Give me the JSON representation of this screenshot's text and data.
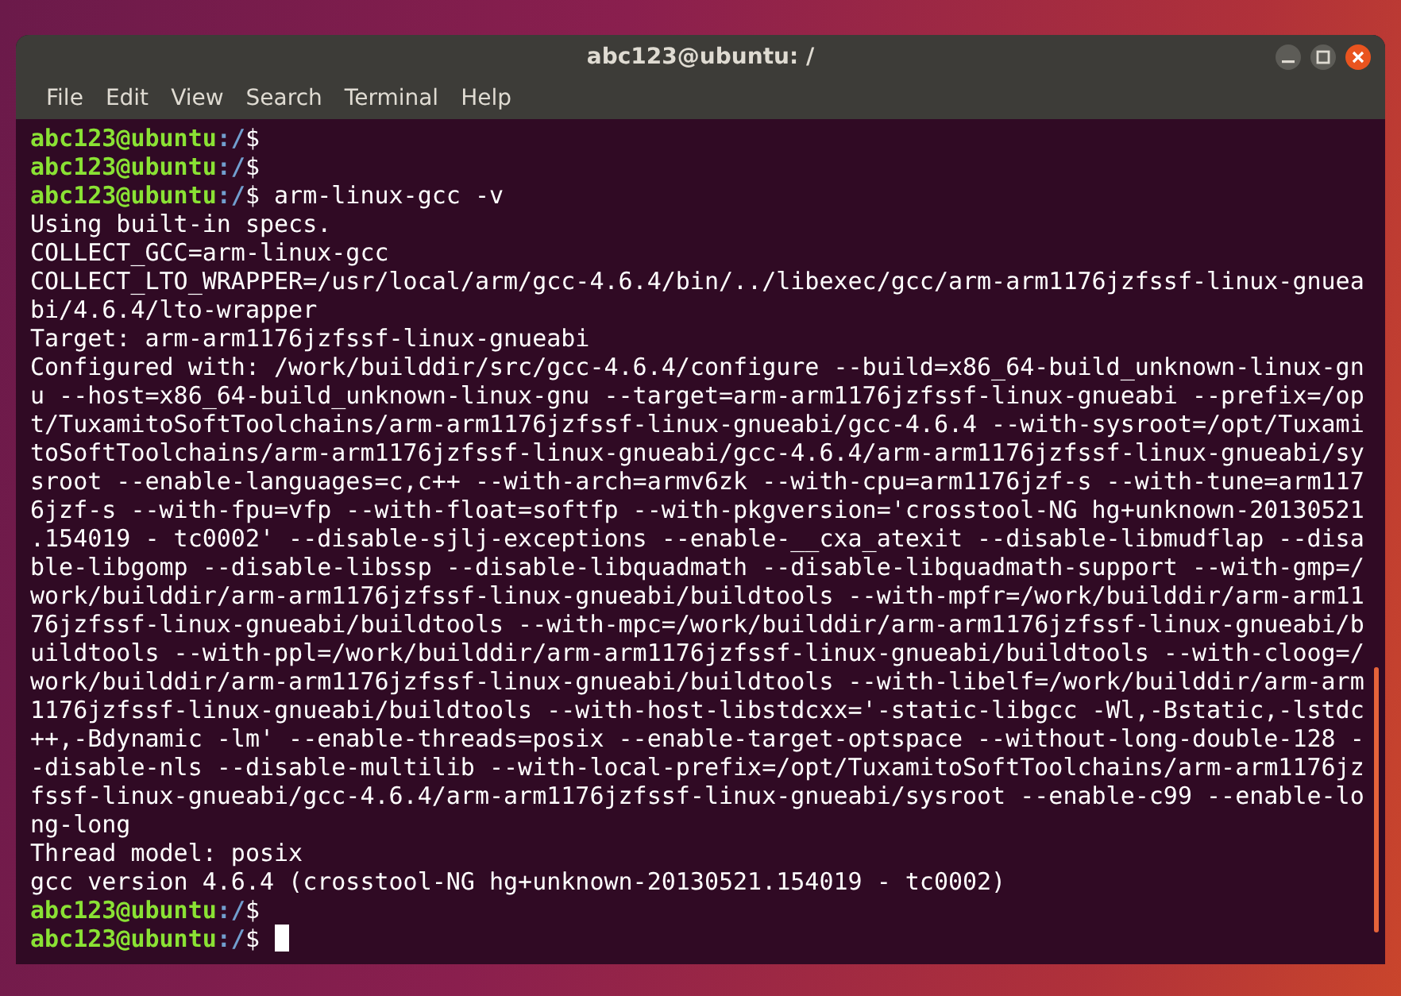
{
  "window": {
    "title": "abc123@ubuntu: /"
  },
  "menu": [
    "File",
    "Edit",
    "View",
    "Search",
    "Terminal",
    "Help"
  ],
  "lines": [
    {
      "kind": "prompt",
      "user": "abc123@ubuntu",
      "path": ":/",
      "symbol": "$",
      "cursor": false
    },
    {
      "kind": "prompt",
      "user": "abc123@ubuntu",
      "path": ":/",
      "symbol": "$",
      "cursor": false
    },
    {
      "kind": "prompt",
      "user": "abc123@ubuntu",
      "path": ":/",
      "symbol": "$",
      "command": "arm-linux-gcc -v",
      "cursor": false
    },
    {
      "kind": "output",
      "text": "Using built-in specs."
    },
    {
      "kind": "output",
      "text": "COLLECT_GCC=arm-linux-gcc"
    },
    {
      "kind": "output",
      "text": "COLLECT_LTO_WRAPPER=/usr/local/arm/gcc-4.6.4/bin/../libexec/gcc/arm-arm1176jzfssf-linux-gnuea"
    },
    {
      "kind": "output",
      "text": "bi/4.6.4/lto-wrapper"
    },
    {
      "kind": "output",
      "text": "Target: arm-arm1176jzfssf-linux-gnueabi"
    },
    {
      "kind": "output",
      "text": "Configured with: /work/builddir/src/gcc-4.6.4/configure --build=x86_64-build_unknown-linux-gn"
    },
    {
      "kind": "output",
      "text": "u --host=x86_64-build_unknown-linux-gnu --target=arm-arm1176jzfssf-linux-gnueabi --prefix=/op"
    },
    {
      "kind": "output",
      "text": "t/TuxamitoSoftToolchains/arm-arm1176jzfssf-linux-gnueabi/gcc-4.6.4 --with-sysroot=/opt/Tuxami"
    },
    {
      "kind": "output",
      "text": "toSoftToolchains/arm-arm1176jzfssf-linux-gnueabi/gcc-4.6.4/arm-arm1176jzfssf-linux-gnueabi/sy"
    },
    {
      "kind": "output",
      "text": "sroot --enable-languages=c,c++ --with-arch=armv6zk --with-cpu=arm1176jzf-s --with-tune=arm117"
    },
    {
      "kind": "output",
      "text": "6jzf-s --with-fpu=vfp --with-float=softfp --with-pkgversion='crosstool-NG hg+unknown-20130521"
    },
    {
      "kind": "output",
      "text": ".154019 - tc0002' --disable-sjlj-exceptions --enable-__cxa_atexit --disable-libmudflap --disa"
    },
    {
      "kind": "output",
      "text": "ble-libgomp --disable-libssp --disable-libquadmath --disable-libquadmath-support --with-gmp=/"
    },
    {
      "kind": "output",
      "text": "work/builddir/arm-arm1176jzfssf-linux-gnueabi/buildtools --with-mpfr=/work/builddir/arm-arm11"
    },
    {
      "kind": "output",
      "text": "76jzfssf-linux-gnueabi/buildtools --with-mpc=/work/builddir/arm-arm1176jzfssf-linux-gnueabi/b"
    },
    {
      "kind": "output",
      "text": "uildtools --with-ppl=/work/builddir/arm-arm1176jzfssf-linux-gnueabi/buildtools --with-cloog=/"
    },
    {
      "kind": "output",
      "text": "work/builddir/arm-arm1176jzfssf-linux-gnueabi/buildtools --with-libelf=/work/builddir/arm-arm"
    },
    {
      "kind": "output",
      "text": "1176jzfssf-linux-gnueabi/buildtools --with-host-libstdcxx='-static-libgcc -Wl,-Bstatic,-lstdc"
    },
    {
      "kind": "output",
      "text": "++,-Bdynamic -lm' --enable-threads=posix --enable-target-optspace --without-long-double-128 -"
    },
    {
      "kind": "output",
      "text": "-disable-nls --disable-multilib --with-local-prefix=/opt/TuxamitoSoftToolchains/arm-arm1176jz"
    },
    {
      "kind": "output",
      "text": "fssf-linux-gnueabi/gcc-4.6.4/arm-arm1176jzfssf-linux-gnueabi/sysroot --enable-c99 --enable-lo"
    },
    {
      "kind": "output",
      "text": "ng-long"
    },
    {
      "kind": "output",
      "text": "Thread model: posix"
    },
    {
      "kind": "output",
      "text": "gcc version 4.6.4 (crosstool-NG hg+unknown-20130521.154019 - tc0002)"
    },
    {
      "kind": "prompt",
      "user": "abc123@ubuntu",
      "path": ":/",
      "symbol": "$",
      "cursor": false
    },
    {
      "kind": "prompt",
      "user": "abc123@ubuntu",
      "path": ":/",
      "symbol": "$",
      "cursor": true
    }
  ]
}
